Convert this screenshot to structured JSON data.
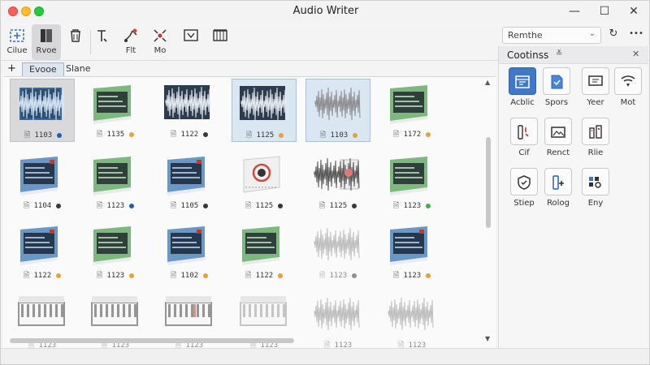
{
  "window": {
    "title": "Audio Writer",
    "minimize": "—",
    "maximize": "☐",
    "close": "✕"
  },
  "toolbar": {
    "buttons": [
      {
        "label": "Cilue",
        "icon": "resize-grid-icon"
      },
      {
        "label": "Rvoe",
        "icon": "book-icon"
      },
      {
        "label": "",
        "icon": "clear-trash-icon"
      },
      {
        "label": "",
        "icon": "text-tool-icon"
      },
      {
        "label": "Flt",
        "icon": "effects-icon"
      },
      {
        "label": "Mo",
        "icon": "monitor-icon"
      },
      {
        "label": "",
        "icon": "mixer-icon"
      },
      {
        "label": "",
        "icon": "output-icon"
      },
      {
        "label": "",
        "icon": "instrument-icon"
      }
    ],
    "combo_value": "Remthe",
    "refresh_icon": "↻",
    "more_icon": "•••"
  },
  "tabs": {
    "add": "+",
    "items": [
      "Evooe",
      "Slane"
    ]
  },
  "grid": {
    "tiles": [
      {
        "caption": "🗎 1103",
        "kind": "wave-blue",
        "dot": "#1e5fb5"
      },
      {
        "caption": "🗎 1135",
        "kind": "green-box",
        "dot": "#e5a13a"
      },
      {
        "caption": "🗎 1122",
        "kind": "wave-dark",
        "dot": "#3a3a3a"
      },
      {
        "caption": "🗎 1125",
        "kind": "wave-dark",
        "dot": "#e5a13a"
      },
      {
        "caption": "🗎 1103",
        "kind": "wave-grey",
        "dot": "#e5a13a"
      },
      {
        "caption": "🗎 1172",
        "kind": "green-box",
        "dot": "#e5a13a"
      },
      {
        "caption": "🗎 1104",
        "kind": "blue-box",
        "dot": "#3a3a3a"
      },
      {
        "caption": "🗎 1123",
        "kind": "green-box",
        "dot": "#1e5fb5"
      },
      {
        "caption": "🗎 1105",
        "kind": "blue-box",
        "dot": "#3a3a3a"
      },
      {
        "caption": "🗎 1125",
        "kind": "red-box",
        "dot": "#3a3a3a"
      },
      {
        "caption": "🗎 1125",
        "kind": "wave-red",
        "dot": "#3a3a3a"
      },
      {
        "caption": "🗎 1123",
        "kind": "green-box",
        "dot": "#3bb54a"
      },
      {
        "caption": "🗎 1122",
        "kind": "blue-box",
        "dot": "#e5a13a"
      },
      {
        "caption": "🗎 1123",
        "kind": "green-box",
        "dot": "#e5a13a"
      },
      {
        "caption": "🗎 1102",
        "kind": "blue-box",
        "dot": "#e5a13a"
      },
      {
        "caption": "🗎 1122",
        "kind": "green-box",
        "dot": "#e5a13a"
      },
      {
        "caption": "🗎 1123",
        "kind": "wave-grey",
        "dot": "#3a3a3a"
      },
      {
        "caption": "🗎 1123",
        "kind": "blue-box",
        "dot": "#e5a13a"
      },
      {
        "caption": "🗎 1123",
        "kind": "piano",
        "dot": ""
      },
      {
        "caption": "🗎 1123",
        "kind": "piano",
        "dot": ""
      },
      {
        "caption": "🗎 1123",
        "kind": "piano-red",
        "dot": ""
      },
      {
        "caption": "🗎 1123",
        "kind": "piano-grey",
        "dot": ""
      },
      {
        "caption": "🗎 1123",
        "kind": "wave-grey",
        "dot": ""
      },
      {
        "caption": "🗎 1123",
        "kind": "wave-grey",
        "dot": ""
      }
    ]
  },
  "panel": {
    "title": "Cootinss",
    "title_icon": "≚",
    "close": "✕",
    "buttons": [
      {
        "label": "Acblic",
        "icon": "calendar-icon",
        "active": true
      },
      {
        "label": "Spors",
        "icon": "document-icon"
      },
      {
        "label": "Yeer",
        "icon": "display-icon"
      },
      {
        "label": "Mot",
        "icon": "wifi-icon"
      },
      {
        "label": "Cif",
        "icon": "edit-icon"
      },
      {
        "label": "Renct",
        "icon": "image-icon"
      },
      {
        "label": "Rlie",
        "icon": "filter-icon"
      },
      {
        "label": "Stiep",
        "icon": "shield-icon"
      },
      {
        "label": "Rolog",
        "icon": "phone-add-icon"
      },
      {
        "label": "Eny",
        "icon": "grid-settings-icon"
      }
    ]
  }
}
